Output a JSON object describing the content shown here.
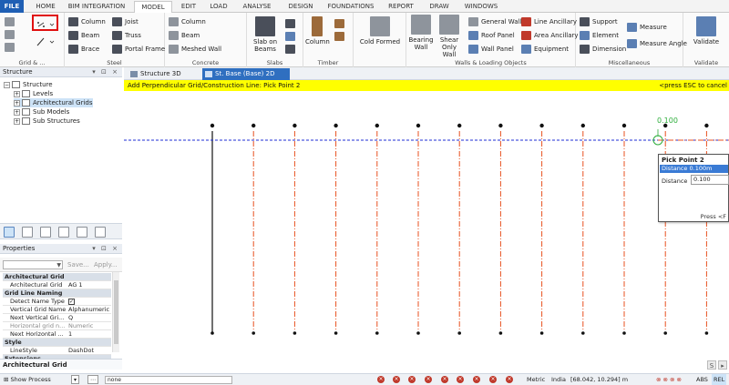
{
  "menu_tabs": [
    "FILE",
    "HOME",
    "BIM INTEGRATION",
    "MODEL",
    "EDIT",
    "LOAD",
    "ANALYSE",
    "DESIGN",
    "FOUNDATIONS",
    "REPORT",
    "DRAW",
    "WINDOWS"
  ],
  "ribbon": {
    "grid_group_label": "Grid & ...",
    "steel": {
      "label": "Steel",
      "column": "Column",
      "beam": "Beam",
      "brace": "Brace",
      "joist": "Joist",
      "truss": "Truss",
      "portal_frame": "Portal Frame"
    },
    "concrete": {
      "label": "Concrete",
      "column": "Column",
      "beam": "Beam",
      "meshed_wall": "Meshed Wall",
      "slab_on_beams": "Slab on Beams"
    },
    "slabs": {
      "label": "Slabs"
    },
    "timber": {
      "label": "Timber",
      "column": "Column"
    },
    "cold_formed": "Cold Formed",
    "walls_loading": {
      "label": "Walls & Loading Objects",
      "bearing_wall": "Bearing Wall",
      "shear_only_wall": "Shear Only Wall",
      "general_wall": "General Wall",
      "roof_panel": "Roof Panel",
      "wall_panel": "Wall Panel",
      "line_ancillary": "Line Ancillary",
      "area_ancillary": "Area Ancillary",
      "equipment": "Equipment"
    },
    "misc": {
      "label": "Miscellaneous",
      "support": "Support",
      "element": "Element",
      "dimension": "Dimension",
      "measure": "Measure",
      "measure_angle": "Measure Angle"
    },
    "validate": {
      "label": "Validate",
      "button": "Validate"
    }
  },
  "structure_pane": {
    "title": "Structure",
    "items": [
      "Structure",
      "Levels",
      "Architectural Grids",
      "Sub Models",
      "Sub Structures"
    ]
  },
  "properties_pane": {
    "title": "Properties",
    "save": "Save...",
    "apply": "Apply...",
    "rows": [
      {
        "type": "cat",
        "key": "Architectural Grid"
      },
      {
        "key": "Architectural Grid",
        "value": "AG 1"
      },
      {
        "type": "cat",
        "key": "Grid Line Naming"
      },
      {
        "key": "Detect Name Type",
        "value": "✓"
      },
      {
        "key": "Vertical Grid Name",
        "value": "Alphanumeric"
      },
      {
        "key": "Next Vertical Gri...",
        "value": "Q"
      },
      {
        "key": "Horizontal grid n...",
        "value": "Numeric"
      },
      {
        "key": "Next Horizontal ...",
        "value": "1"
      },
      {
        "type": "cat",
        "key": "Style"
      },
      {
        "key": "LineStyle",
        "value": "DashDot"
      },
      {
        "type": "cat",
        "key": "Extensions"
      }
    ],
    "footer": "Architectural Grid"
  },
  "document_tabs": [
    "Structure 3D",
    "St. Base (Base) 2D"
  ],
  "status_message": "Add Perpendicular Grid/Construction Line: Pick Point 2",
  "status_hint": "<press ESC to cancel",
  "canvas": {
    "dimension_label": "0.100",
    "grid_line_count": 13
  },
  "pick_popup": {
    "title": "Pick Point 2",
    "selected": "Distance 0.100m",
    "distance_label": "Distance",
    "distance_value": "0.100",
    "hint": "Press <F"
  },
  "bottom_bar": {
    "show_process": "Show Process",
    "input": "none",
    "metric": "Metric",
    "region": "India",
    "coords": "[68.042, 10.294] m",
    "abs": "ABS",
    "rel": "REL"
  },
  "colors": {
    "accent": "#1f5fb4",
    "status_yellow": "#ffff00",
    "grid_orange": "#e8501f",
    "construction_blue": "#1f2fd6",
    "pick_green": "#2eae3c",
    "highlight_red": "#e01010"
  }
}
